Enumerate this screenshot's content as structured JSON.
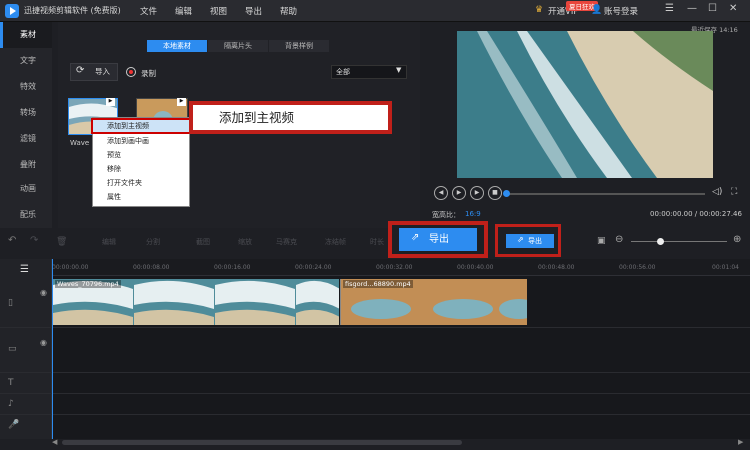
{
  "app": {
    "title": "迅捷视频剪辑软件 (免费版)"
  },
  "menu": [
    "文件",
    "编辑",
    "视图",
    "导出",
    "帮助"
  ],
  "titlebar": {
    "vip_label": "开通VIP",
    "vip_badge": "夏日狂欢",
    "login_label": "账号登录",
    "last_saved": "最近保存 14:16"
  },
  "sidebar": {
    "items": [
      {
        "label": "素材"
      },
      {
        "label": "文字"
      },
      {
        "label": "特效"
      },
      {
        "label": "转场"
      },
      {
        "label": "滤镜"
      },
      {
        "label": "叠附"
      },
      {
        "label": "动画"
      },
      {
        "label": "配乐"
      }
    ]
  },
  "library": {
    "tabs": [
      {
        "label": "本地素材"
      },
      {
        "label": "隔离片头"
      },
      {
        "label": "背景样例"
      }
    ],
    "import_label": "导入",
    "record_label": "录制",
    "filter_value": "全部",
    "thumb_label": "Wave"
  },
  "context_menu": {
    "items": [
      {
        "label": "添加到主视频"
      },
      {
        "label": "添加到画中画"
      },
      {
        "label": "预览"
      },
      {
        "label": "移除"
      },
      {
        "label": "打开文件夹"
      },
      {
        "label": "属性"
      }
    ]
  },
  "callout": {
    "text": "添加到主视频"
  },
  "preview": {
    "aspect_label": "宽高比：",
    "aspect_value": "16:9",
    "time": "00:00:00.00 / 00:00:27.46",
    "progress": 0
  },
  "toolbar": {
    "tools": [
      "编辑",
      "分割",
      "截图",
      "缩放",
      "马赛克",
      "冻结帧",
      "时长"
    ],
    "export_label": "导出",
    "export_small_label": "导出"
  },
  "timeline": {
    "ruler": [
      "00:00:00.00",
      "00:00:08.00",
      "00:00:16.00",
      "00:00:24.00",
      "00:00:32.00",
      "00:00:40.00",
      "00:00:48.00",
      "00:00:56.00",
      "00:01:04"
    ],
    "clips": [
      {
        "label": "Waves_70796.mp4"
      },
      {
        "label": "fisgord...68890.mp4"
      }
    ]
  },
  "colors": {
    "accent": "#2d8cf0",
    "highlight_border": "#c0201a",
    "background": "#1e1f24"
  }
}
